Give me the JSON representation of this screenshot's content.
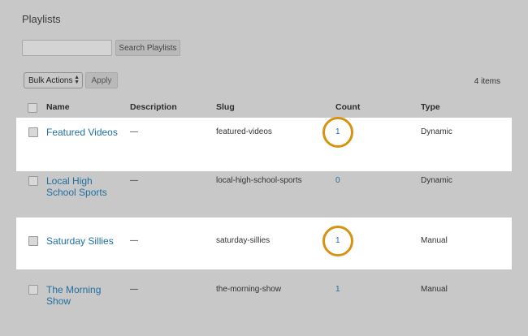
{
  "page": {
    "title": "Playlists"
  },
  "search": {
    "value": "",
    "button_label": "Search Playlists"
  },
  "bulk": {
    "selected": "Bulk Actions",
    "apply_label": "Apply"
  },
  "items_count": "4 items",
  "table": {
    "headers": {
      "name": "Name",
      "description": "Description",
      "slug": "Slug",
      "count": "Count",
      "type": "Type"
    },
    "rows": [
      {
        "name_line1": "Featured Videos",
        "name_line2": "",
        "description": "—",
        "slug": "featured-videos",
        "count": "1",
        "type": "Dynamic",
        "highlighted": true
      },
      {
        "name_line1": "Local High",
        "name_line2": "School Sports",
        "description": "—",
        "slug": "local-high-school-sports",
        "count": "0",
        "type": "Dynamic",
        "highlighted": false
      },
      {
        "name_line1": "Saturday Sillies",
        "name_line2": "",
        "description": "—",
        "slug": "saturday-sillies",
        "count": "1",
        "type": "Manual",
        "highlighted": true
      },
      {
        "name_line1": "The Morning",
        "name_line2": "Show",
        "description": "—",
        "slug": "the-morning-show",
        "count": "1",
        "type": "Manual",
        "highlighted": false
      }
    ]
  },
  "colors": {
    "background": "#c8c8c8",
    "row_highlight": "#ffffff",
    "link": "#1f6fa1",
    "ring": "#d7920f"
  }
}
